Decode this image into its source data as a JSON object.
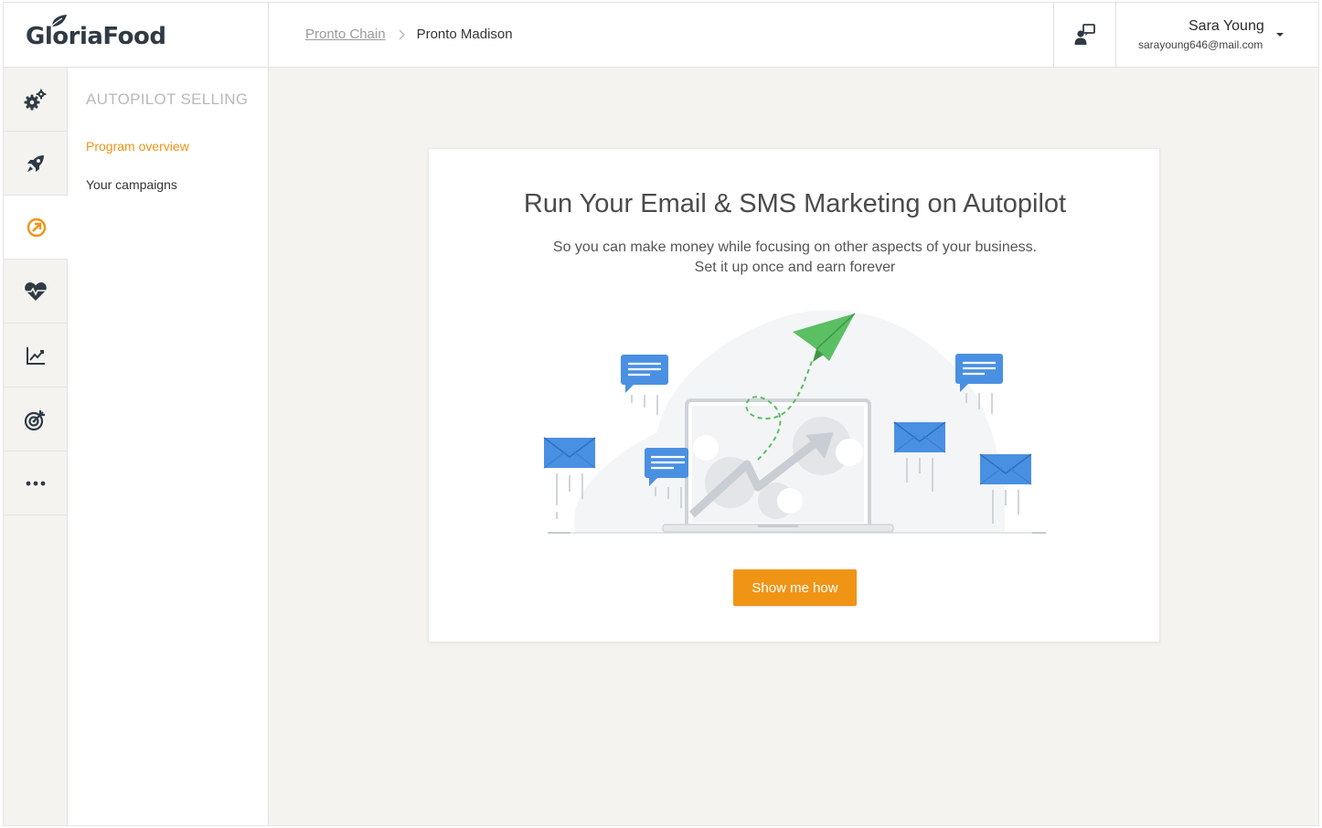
{
  "brand": {
    "logo_text": "GloriaFood"
  },
  "breadcrumb": {
    "parent": "Pronto Chain",
    "current": "Pronto Madison"
  },
  "user": {
    "name": "Sara Young",
    "email": "sarayoung646@mail.com"
  },
  "rail": [
    {
      "icon": "gears-icon"
    },
    {
      "icon": "rocket-icon"
    },
    {
      "icon": "autopilot-icon",
      "active": true
    },
    {
      "icon": "heart-pulse-icon"
    },
    {
      "icon": "line-chart-icon"
    },
    {
      "icon": "target-icon"
    },
    {
      "icon": "more-icon"
    }
  ],
  "subnav": {
    "title": "AUTOPILOT SELLING",
    "items": [
      {
        "label": "Program overview",
        "active": true
      },
      {
        "label": "Your campaigns",
        "active": false
      }
    ]
  },
  "card": {
    "title": "Run Your Email & SMS Marketing on Autopilot",
    "subtitle_line1": "So you can make money while focusing on other aspects of your business.",
    "subtitle_line2": "Set it up once and earn forever",
    "cta_label": "Show me how"
  },
  "colors": {
    "accent": "#f09416",
    "text_dark": "#2f3a44",
    "illustration_blue": "#4a90e2",
    "illustration_green": "#4caf50"
  }
}
